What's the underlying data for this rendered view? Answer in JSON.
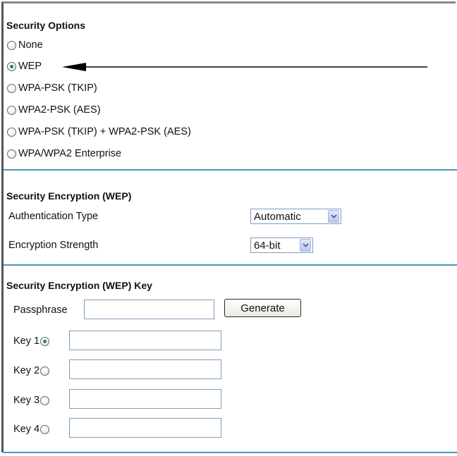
{
  "security_options": {
    "heading": "Security Options",
    "options": [
      {
        "label": "None",
        "checked": false
      },
      {
        "label": "WEP",
        "checked": true
      },
      {
        "label": "WPA-PSK (TKIP)",
        "checked": false
      },
      {
        "label": "WPA2-PSK (AES)",
        "checked": false
      },
      {
        "label": "WPA-PSK (TKIP) + WPA2-PSK (AES)",
        "checked": false
      },
      {
        "label": "WPA/WPA2 Enterprise",
        "checked": false
      }
    ]
  },
  "encryption": {
    "heading": "Security Encryption (WEP)",
    "auth_label": "Authentication Type",
    "auth_value": "Automatic",
    "strength_label": "Encryption Strength",
    "strength_value": "64-bit"
  },
  "keys": {
    "heading": "Security Encryption (WEP) Key",
    "passphrase_label": "Passphrase",
    "passphrase_value": "",
    "generate_label": "Generate",
    "rows": [
      {
        "label": "Key 1",
        "checked": true,
        "value": ""
      },
      {
        "label": "Key 2",
        "checked": false,
        "value": ""
      },
      {
        "label": "Key 3",
        "checked": false,
        "value": ""
      },
      {
        "label": "Key 4",
        "checked": false,
        "value": ""
      }
    ]
  },
  "colors": {
    "separator": "#4a98c0",
    "radio_dot": "#2c8a2a",
    "input_border": "#7f9db9"
  }
}
